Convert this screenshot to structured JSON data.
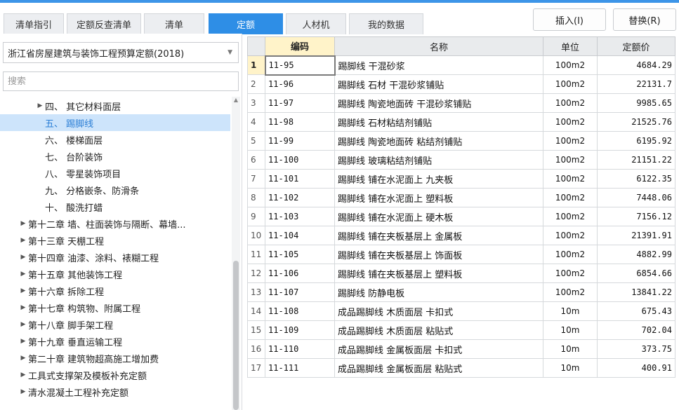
{
  "tabs": [
    {
      "label": "清单指引",
      "active": false
    },
    {
      "label": "定额反查清单",
      "active": false
    },
    {
      "label": "清单",
      "active": false
    },
    {
      "label": "定额",
      "active": true
    },
    {
      "label": "人材机",
      "active": false
    },
    {
      "label": "我的数据",
      "active": false
    }
  ],
  "buttons": {
    "insert": "插入(I)",
    "replace": "替换(R)"
  },
  "left": {
    "dropdown_value": "浙江省房屋建筑与装饰工程预算定额(2018)",
    "search_placeholder": "搜索",
    "tree": [
      {
        "label": "四、 其它材料面层",
        "caret": true,
        "selected": false
      },
      {
        "label": "五、 踢脚线",
        "caret": false,
        "selected": true
      },
      {
        "label": "六、 楼梯面层",
        "caret": false,
        "selected": false
      },
      {
        "label": "七、 台阶装饰",
        "caret": false,
        "selected": false
      },
      {
        "label": "八、 零星装饰项目",
        "caret": false,
        "selected": false
      },
      {
        "label": "九、 分格嵌条、防滑条",
        "caret": false,
        "selected": false
      },
      {
        "label": "十、 酸洗打蜡",
        "caret": false,
        "selected": false
      },
      {
        "label": "第十二章 墙、柱面装饰与隔断、幕墙...",
        "caret": true,
        "selected": false
      },
      {
        "label": "第十三章 天棚工程",
        "caret": true,
        "selected": false
      },
      {
        "label": "第十四章 油漆、涂料、裱糊工程",
        "caret": true,
        "selected": false
      },
      {
        "label": "第十五章 其他装饰工程",
        "caret": true,
        "selected": false
      },
      {
        "label": "第十六章 拆除工程",
        "caret": true,
        "selected": false
      },
      {
        "label": "第十七章 构筑物、附属工程",
        "caret": true,
        "selected": false
      },
      {
        "label": "第十八章 脚手架工程",
        "caret": true,
        "selected": false
      },
      {
        "label": "第十九章 垂直运输工程",
        "caret": true,
        "selected": false
      },
      {
        "label": "第二十章 建筑物超高施工增加费",
        "caret": true,
        "selected": false
      },
      {
        "label": "工具式支撑架及模板补充定额",
        "caret": true,
        "selected": false
      },
      {
        "label": "清水混凝土工程补充定额",
        "caret": true,
        "selected": false
      }
    ]
  },
  "table": {
    "headers": {
      "code": "编码",
      "name": "名称",
      "unit": "单位",
      "price": "定额价"
    },
    "rows": [
      {
        "idx": "1",
        "code": "11-95",
        "name": "踢脚线 干混砂浆",
        "unit": "100m2",
        "price": "4684.29"
      },
      {
        "idx": "2",
        "code": "11-96",
        "name": "踢脚线 石材 干混砂浆铺贴",
        "unit": "100m2",
        "price": "22131.7"
      },
      {
        "idx": "3",
        "code": "11-97",
        "name": "踢脚线 陶瓷地面砖 干混砂浆铺贴",
        "unit": "100m2",
        "price": "9985.65"
      },
      {
        "idx": "4",
        "code": "11-98",
        "name": "踢脚线 石材粘结剂铺贴",
        "unit": "100m2",
        "price": "21525.76"
      },
      {
        "idx": "5",
        "code": "11-99",
        "name": "踢脚线 陶瓷地面砖 粘结剂铺贴",
        "unit": "100m2",
        "price": "6195.92"
      },
      {
        "idx": "6",
        "code": "11-100",
        "name": "踢脚线 玻璃粘结剂铺贴",
        "unit": "100m2",
        "price": "21151.22"
      },
      {
        "idx": "7",
        "code": "11-101",
        "name": "踢脚线 铺在水泥面上 九夹板",
        "unit": "100m2",
        "price": "6122.35"
      },
      {
        "idx": "8",
        "code": "11-102",
        "name": "踢脚线 铺在水泥面上 塑料板",
        "unit": "100m2",
        "price": "7448.06"
      },
      {
        "idx": "9",
        "code": "11-103",
        "name": "踢脚线 铺在水泥面上 硬木板",
        "unit": "100m2",
        "price": "7156.12"
      },
      {
        "idx": "10",
        "code": "11-104",
        "name": "踢脚线 铺在夹板基层上 金属板",
        "unit": "100m2",
        "price": "21391.91"
      },
      {
        "idx": "11",
        "code": "11-105",
        "name": "踢脚线 铺在夹板基层上 饰面板",
        "unit": "100m2",
        "price": "4882.99"
      },
      {
        "idx": "12",
        "code": "11-106",
        "name": "踢脚线 铺在夹板基层上 塑料板",
        "unit": "100m2",
        "price": "6854.66"
      },
      {
        "idx": "13",
        "code": "11-107",
        "name": "踢脚线 防静电板",
        "unit": "100m2",
        "price": "13841.22"
      },
      {
        "idx": "14",
        "code": "11-108",
        "name": "成品踢脚线 木质面层 卡扣式",
        "unit": "10m",
        "price": "675.43"
      },
      {
        "idx": "15",
        "code": "11-109",
        "name": "成品踢脚线 木质面层 粘贴式",
        "unit": "10m",
        "price": "702.04"
      },
      {
        "idx": "16",
        "code": "11-110",
        "name": "成品踢脚线 金属板面层 卡扣式",
        "unit": "10m",
        "price": "373.75"
      },
      {
        "idx": "17",
        "code": "11-111",
        "name": "成品踢脚线 金属板面层 粘贴式",
        "unit": "10m",
        "price": "400.91"
      }
    ]
  },
  "colors": {
    "accent": "#2e8ee6",
    "selected_bg": "#cde4fb",
    "current_row": "#fff3c9"
  }
}
